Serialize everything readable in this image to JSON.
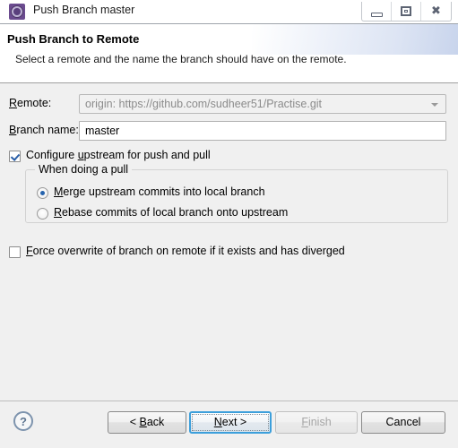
{
  "window": {
    "title": "Push Branch master",
    "icon": "eclipse-gear-icon",
    "controls": {
      "minimize": "minimize-icon",
      "restore": "restore-icon",
      "close": "close-icon"
    }
  },
  "header": {
    "title": "Push Branch to Remote",
    "description": "Select a remote and the name the branch should have on the remote."
  },
  "form": {
    "remote": {
      "label_pre": "R",
      "label_mn": "",
      "label": "emote:",
      "label_full": "Remote:",
      "value": "origin: https://github.com/sudheer51/Practise.git",
      "enabled": "false"
    },
    "branch_name": {
      "label_full": "Branch name:",
      "value": "master",
      "placeholder": ""
    },
    "configure_upstream": {
      "label_full": "Configure upstream for push and pull",
      "checked": "true"
    },
    "group": {
      "title": "When doing a pull",
      "options": [
        {
          "label_full": "Merge upstream commits into local branch",
          "selected": "true"
        },
        {
          "label_full": "Rebase commits of local branch onto upstream",
          "selected": "false"
        }
      ]
    },
    "force_overwrite": {
      "label_full": "Force overwrite of branch on remote if it exists and has diverged",
      "checked": "false"
    }
  },
  "footer": {
    "help": "?",
    "buttons": [
      {
        "label": "< Back",
        "state": "enabled"
      },
      {
        "label": "Next >",
        "state": "focused"
      },
      {
        "label": "Finish",
        "state": "disabled"
      },
      {
        "label": "Cancel",
        "state": "enabled"
      }
    ]
  },
  "colors": {
    "accent": "#3c9fdb",
    "check": "#2a5fa8",
    "radio": "#2663ad",
    "dialog_bg": "#f0f0f0",
    "title_icon": "#6b4b8f"
  }
}
